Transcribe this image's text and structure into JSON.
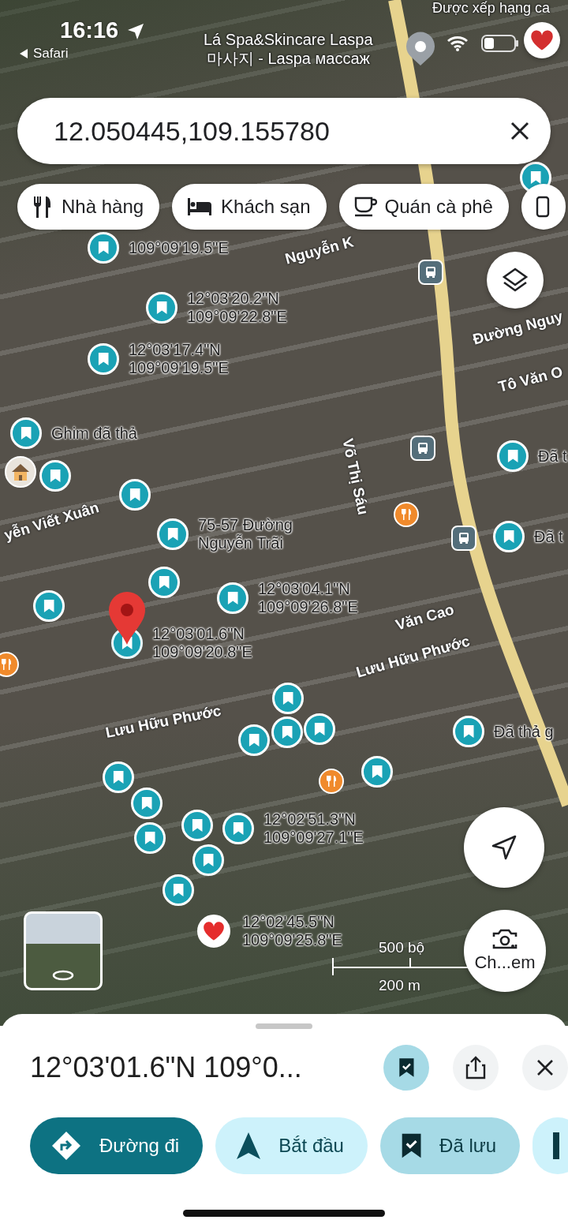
{
  "status_bar": {
    "time": "16:16",
    "back_label": "Safari"
  },
  "search": {
    "value": "12.050445,109.155780"
  },
  "chips": [
    {
      "label": "Nhà hàng",
      "kind": "restaurant"
    },
    {
      "label": "Khách sạn",
      "kind": "hotel"
    },
    {
      "label": "Quán cà phê",
      "kind": "cafe"
    },
    {
      "kind": "more"
    }
  ],
  "map": {
    "places": [
      "Được xếp hạng ca",
      "Lá Spa&Skincare Laspa\n마사지 - Laspa массаж"
    ],
    "streets": [
      "Nguyễn K",
      "Đường Nguy",
      "Tô Văn O",
      "yễn Viết Xuân",
      "Võ Thị Sáu",
      "Văn Cao",
      "Lưu Hữu Phước",
      "Lưu Hữu Phước"
    ],
    "markers": [
      {
        "kind": "pin",
        "label": "109°09'19.5\"E",
        "selected": false
      },
      {
        "kind": "pin",
        "selected": false
      },
      {
        "kind": "bus"
      },
      {
        "kind": "pin",
        "label": "12°03'20.2\"N\n109°09'22.8\"E",
        "selected": false
      },
      {
        "kind": "pin",
        "label": "12°03'17.4\"N\n109°09'19.5\"E",
        "selected": false
      },
      {
        "kind": "pin",
        "label": "Ghim đã thả",
        "selected": false
      },
      {
        "kind": "bus"
      },
      {
        "kind": "pin",
        "label": "Đã t",
        "selected": false
      },
      {
        "kind": "house"
      },
      {
        "kind": "pin",
        "selected": false
      },
      {
        "kind": "pin",
        "selected": false
      },
      {
        "kind": "restaurant"
      },
      {
        "kind": "pin",
        "label": "75-57 Đường\nNguyễn Trãi",
        "selected": false
      },
      {
        "kind": "bus"
      },
      {
        "kind": "pin",
        "label": "Đã t",
        "selected": false
      },
      {
        "kind": "pin",
        "selected": false
      },
      {
        "kind": "pin",
        "selected": false
      },
      {
        "kind": "pin",
        "label": "12°03'04.1\"N\n109°09'26.8\"E",
        "selected": false
      },
      {
        "kind": "pin",
        "label": "12°03'01.6\"N\n109°09'20.8\"E",
        "selected": true
      },
      {
        "kind": "restaurant"
      },
      {
        "kind": "pin",
        "selected": false
      },
      {
        "kind": "pin",
        "selected": false
      },
      {
        "kind": "pin",
        "selected": false
      },
      {
        "kind": "pin",
        "selected": false
      },
      {
        "kind": "pin",
        "label": "Đã thả g",
        "selected": false
      },
      {
        "kind": "pin",
        "selected": false
      },
      {
        "kind": "pin",
        "selected": false
      },
      {
        "kind": "restaurant"
      },
      {
        "kind": "pin",
        "selected": false
      },
      {
        "kind": "pin",
        "selected": false
      },
      {
        "kind": "pin",
        "selected": false
      },
      {
        "kind": "pin",
        "label": "12°02'51.3\"N\n109°09'27.1\"E",
        "selected": false
      },
      {
        "kind": "pin",
        "selected": false
      },
      {
        "kind": "pin",
        "selected": false
      },
      {
        "kind": "heart",
        "label": "12°02'45.5\"N\n109°09'25.8\"E"
      }
    ],
    "scale": [
      "500 bộ",
      "200 m"
    ]
  },
  "camera_button": {
    "label": "Ch...em"
  },
  "place_sheet": {
    "title": "12°03'01.6\"N 109°0...",
    "saved": true,
    "actions": [
      {
        "label": "Đường đi",
        "kind": "directions"
      },
      {
        "label": "Bắt đầu",
        "kind": "start"
      },
      {
        "label": "Đã lưu",
        "kind": "saved"
      },
      {
        "kind": "more"
      }
    ]
  }
}
